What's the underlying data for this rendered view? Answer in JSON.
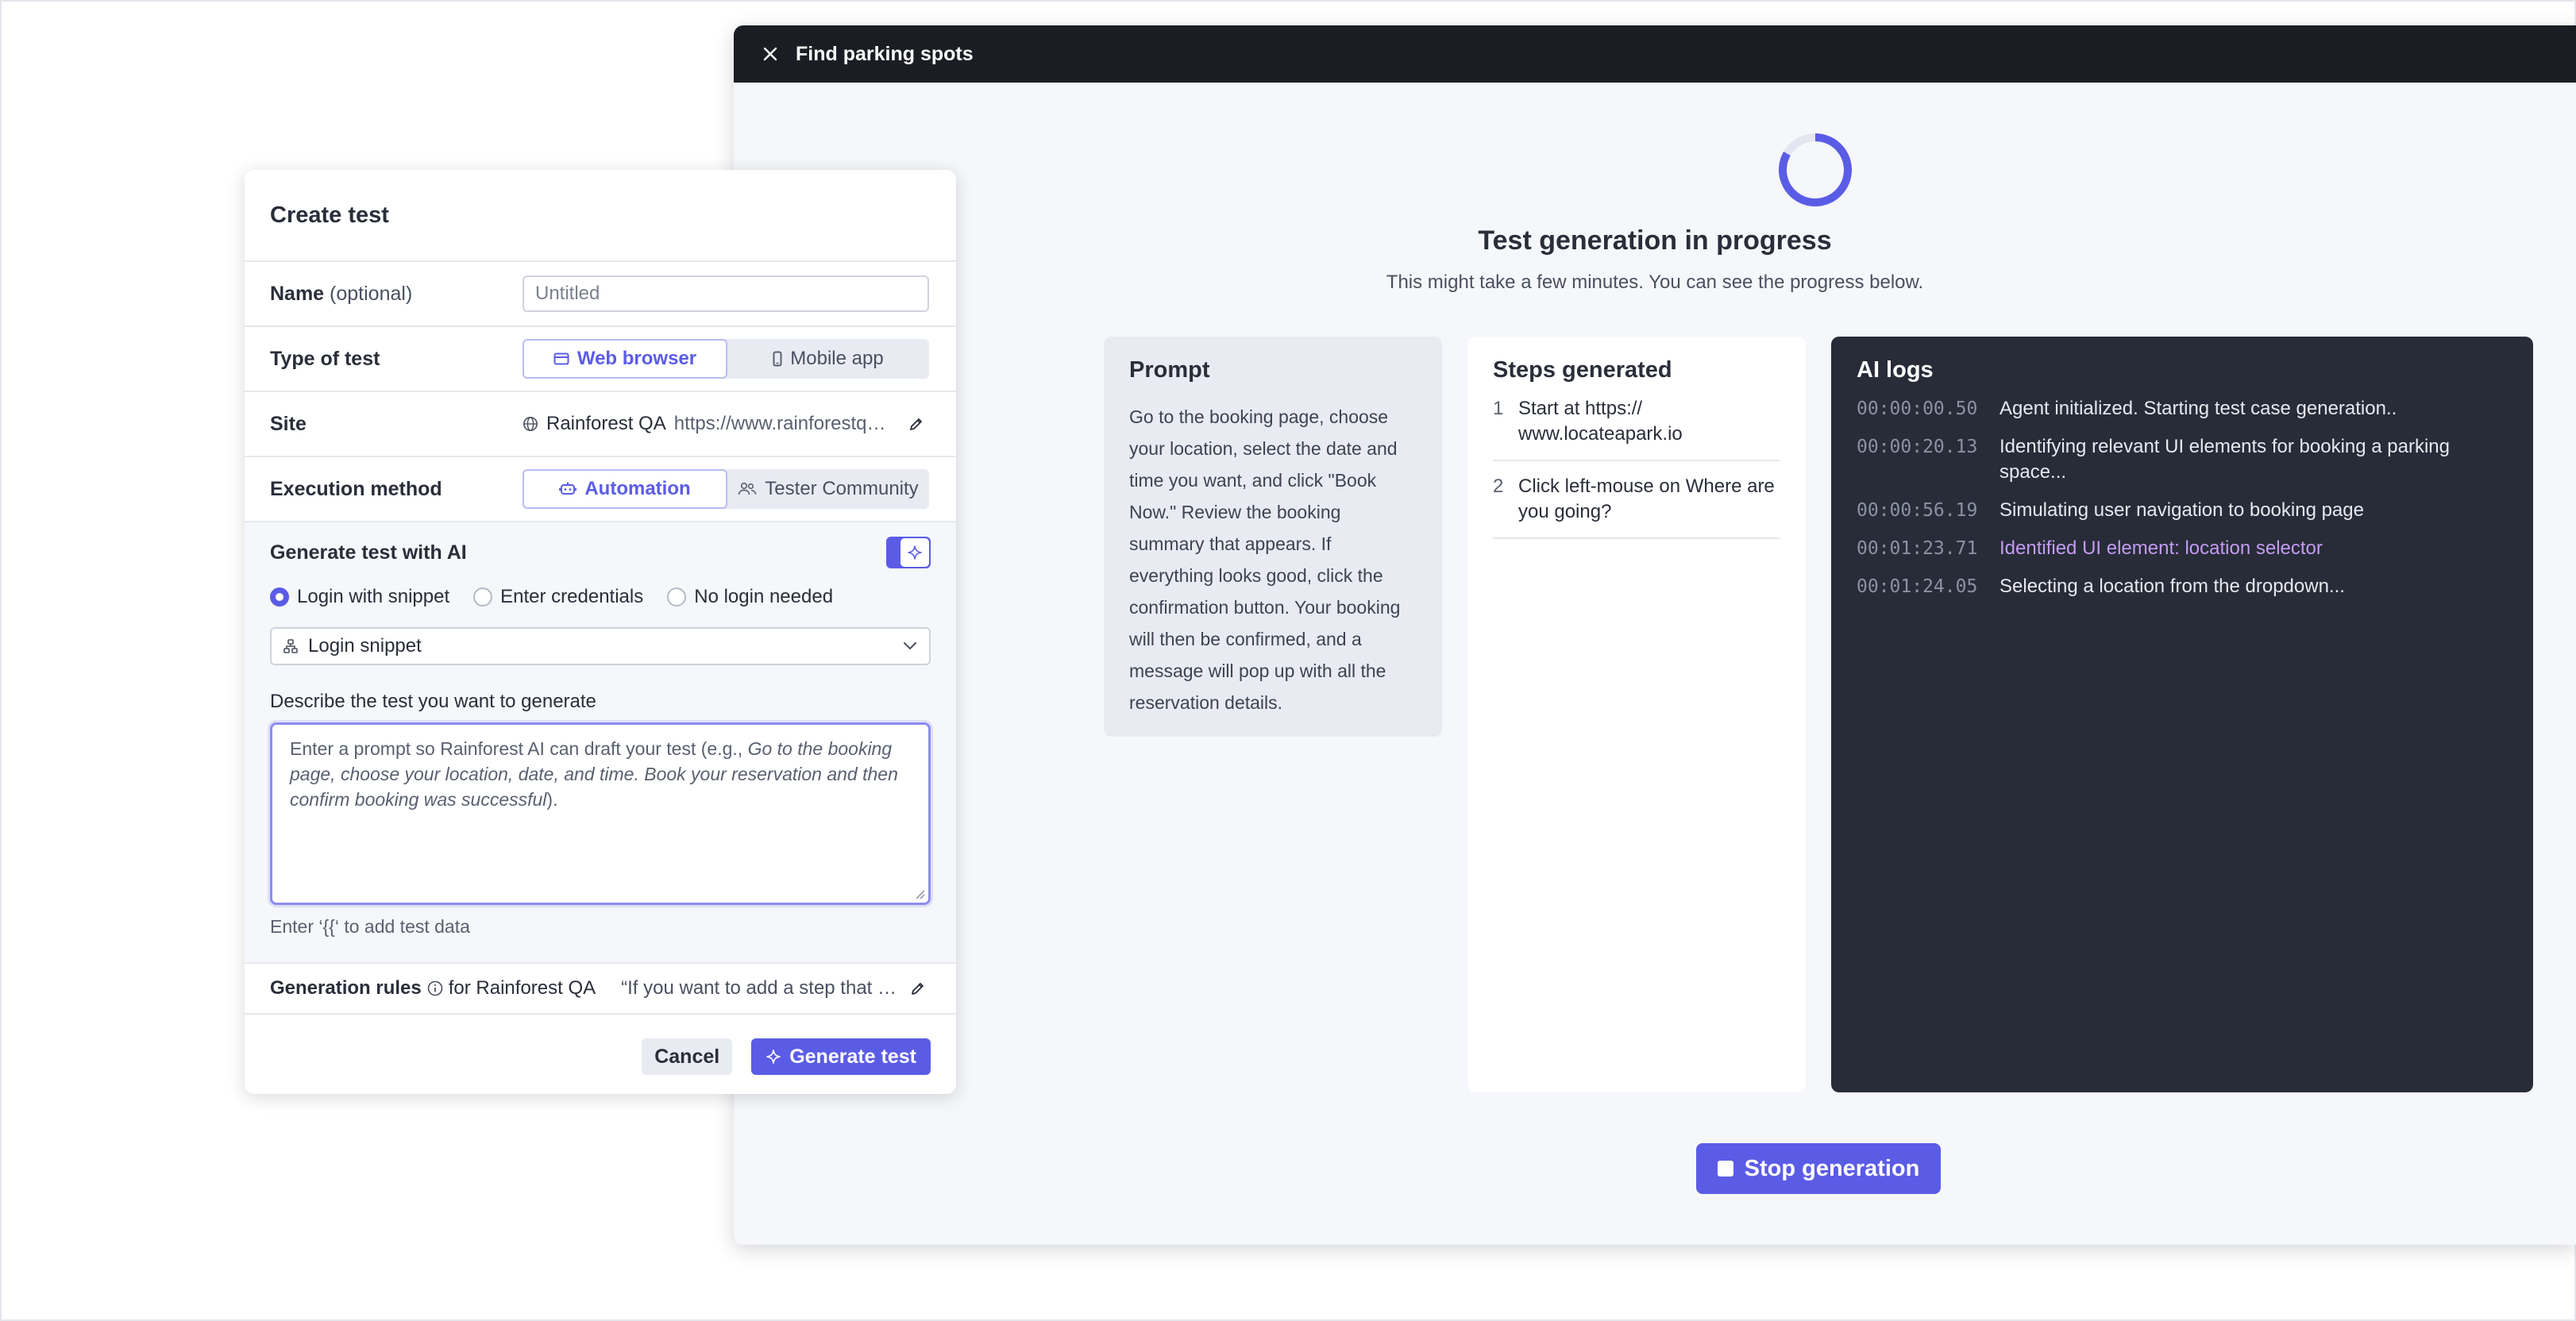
{
  "colors": {
    "accent": "#5b5ce6",
    "dark_bar": "#1b1d24",
    "logs_bg": "#272c38",
    "log_highlight": "#c49cf2"
  },
  "window": {
    "title": "Find parking spots",
    "close_icon": "close-icon"
  },
  "progress": {
    "title": "Test generation in progress",
    "subtitle": "This might take a few minutes. You can see the progress below.",
    "stop_label": "Stop generation"
  },
  "prompt_card": {
    "title": "Prompt",
    "text": "Go to the booking page, choose your location, select the date and time you want, and click \"Book Now.\" Review the booking summary that appears. If everything looks good, click the confirmation button. Your booking will then be confirmed, and a message will pop up with all the reservation details."
  },
  "steps_card": {
    "title": "Steps generated",
    "steps": [
      {
        "num": "1",
        "text": "Start at https:// www.locateapark.io"
      },
      {
        "num": "2",
        "text": "Click left-mouse on Where are you going?"
      }
    ]
  },
  "logs_card": {
    "title": "AI logs",
    "logs": [
      {
        "time": "00:00:00.50",
        "msg": "Agent initialized. Starting test case generation.."
      },
      {
        "time": "00:00:20.13",
        "msg": "Identifying relevant UI elements for booking a parking space..."
      },
      {
        "time": "00:00:56.19",
        "msg": "Simulating user navigation to booking page"
      },
      {
        "time": "00:01:23.71",
        "msg": "Identified UI element: location selector",
        "highlight": true
      },
      {
        "time": "00:01:24.05",
        "msg": "Selecting a location from the dropdown..."
      }
    ]
  },
  "create": {
    "title": "Create test",
    "name_label": "Name",
    "name_optional": "(optional)",
    "name_placeholder": "Untitled",
    "type_label": "Type of test",
    "type_options": [
      "Web browser",
      "Mobile app"
    ],
    "site_label": "Site",
    "site_name": "Rainforest QA",
    "site_url": "https://www.rainforestqa.com",
    "exec_label": "Execution method",
    "exec_options": [
      "Automation",
      "Tester Community"
    ],
    "ai_title": "Generate test with AI",
    "login_options": [
      "Login with snippet",
      "Enter credentials",
      "No login needed"
    ],
    "snippet_value": "Login snippet",
    "describe_label": "Describe the test you want to generate",
    "textarea_prefix": "Enter a prompt so Rainforest AI can draft your test (e.g., ",
    "textarea_example": "Go to the booking page, choose your location, date, and time. Book your reservation and then confirm booking was successful",
    "textarea_suffix": ").",
    "hint": "Enter ‘{{‘ to add test data",
    "rules_label": "Generation rules",
    "rules_for": "for Rainforest QA",
    "rules_quote": "“If you want to add a step that opens a new tab...",
    "cancel_label": "Cancel",
    "generate_label": "Generate test"
  }
}
